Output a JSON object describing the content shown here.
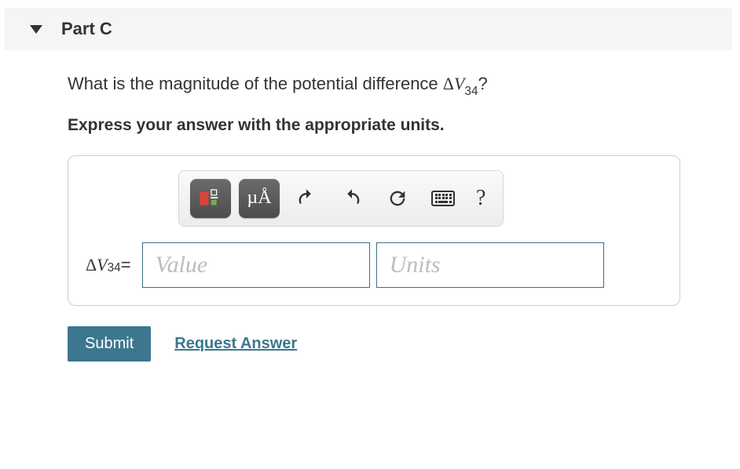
{
  "part": {
    "label": "Part C"
  },
  "question": {
    "prefix": "What is the magnitude of the potential difference ",
    "var_delta": "Δ",
    "var_v": "V",
    "var_sub": "34",
    "suffix": "?"
  },
  "instruction": "Express your answer with the appropriate units.",
  "toolbar": {
    "units_symbol": "µÅ",
    "help_symbol": "?"
  },
  "answer": {
    "label_delta": "Δ",
    "label_v": "V",
    "label_sub": "34",
    "label_eq": " = ",
    "value_placeholder": "Value",
    "units_placeholder": "Units"
  },
  "actions": {
    "submit": "Submit",
    "request": "Request Answer"
  }
}
